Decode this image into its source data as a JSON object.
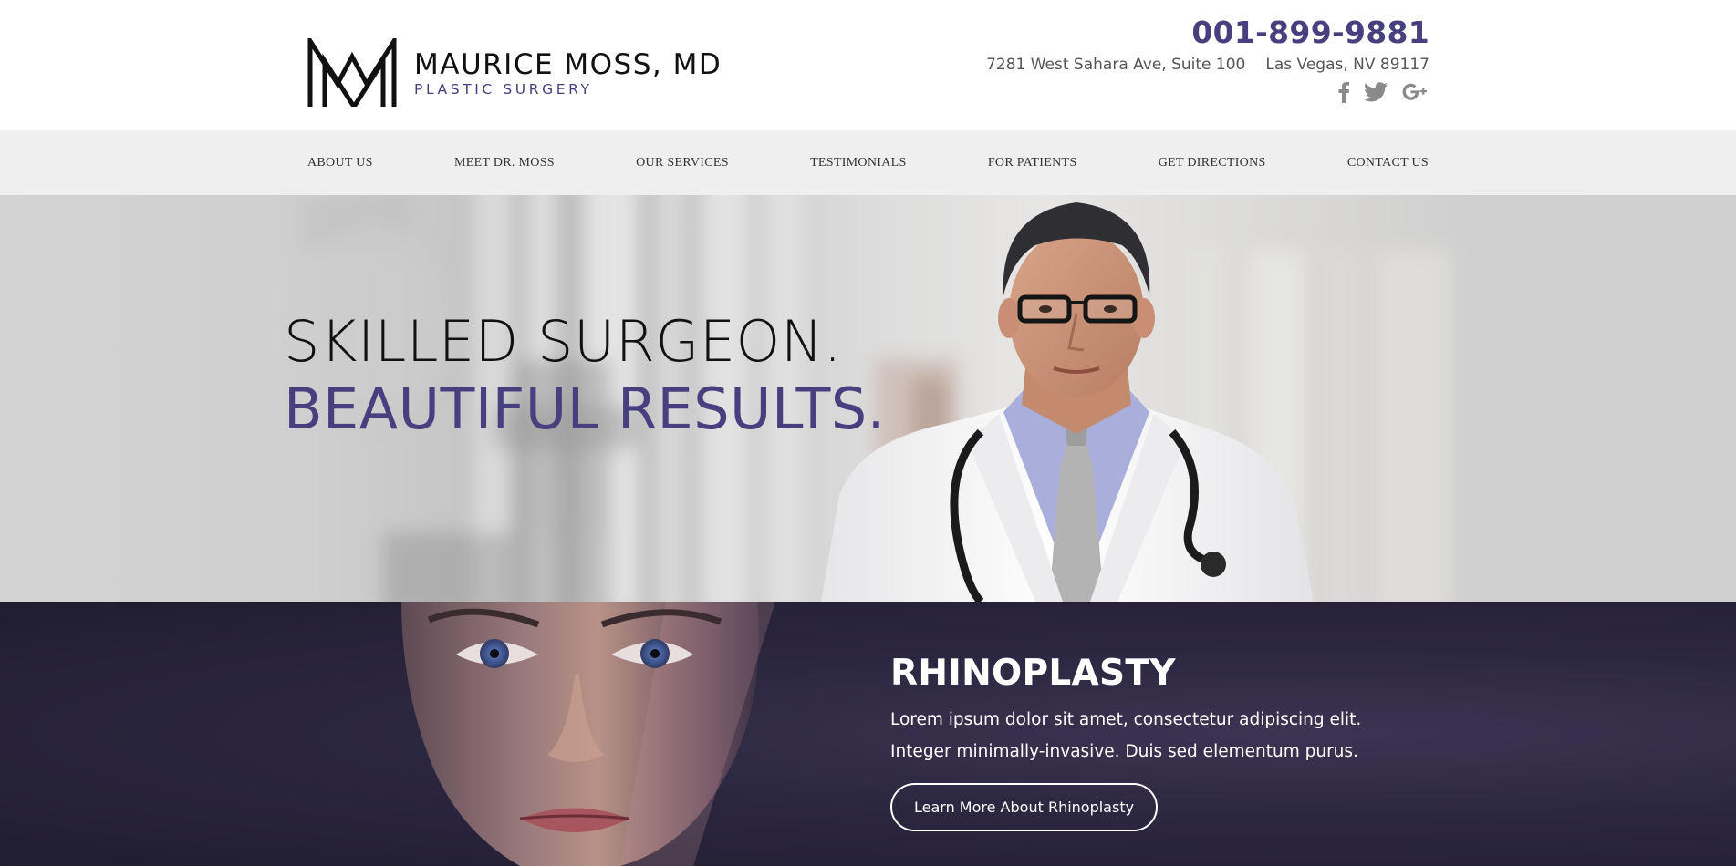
{
  "header": {
    "logo": {
      "monogram": "MM",
      "name": "MAURICE MOSS, MD",
      "tagline": "PLASTIC SURGERY"
    },
    "contact": {
      "phone": "001-899-9881",
      "address_street": "7281 West Sahara Ave, Suite 100",
      "address_city": "Las Vegas, NV 89117"
    },
    "social": [
      {
        "icon": "facebook-icon"
      },
      {
        "icon": "twitter-icon"
      },
      {
        "icon": "google-plus-icon"
      }
    ]
  },
  "nav": {
    "items": [
      {
        "label": "ABOUT US"
      },
      {
        "label": "MEET DR. MOSS"
      },
      {
        "label": "OUR SERVICES"
      },
      {
        "label": "TESTIMONIALS"
      },
      {
        "label": "FOR PATIENTS"
      },
      {
        "label": "GET DIRECTIONS"
      },
      {
        "label": "CONTACT US"
      }
    ]
  },
  "hero": {
    "line1": "SKILLED SURGEON.",
    "line2": "BEAUTIFUL RESULTS."
  },
  "feature": {
    "title": "RHINOPLASTY",
    "body": "Lorem ipsum dolor sit amet, consectetur adipiscing elit. Integer minimally-invasive. Duis sed elementum purus.",
    "button_label": "Learn More About Rhinoplasty"
  },
  "colors": {
    "brand_purple": "#48407e",
    "nav_bg": "#efefef",
    "feature_bg": "#2a2540",
    "text_dark": "#111111",
    "text_gray": "#555555"
  }
}
